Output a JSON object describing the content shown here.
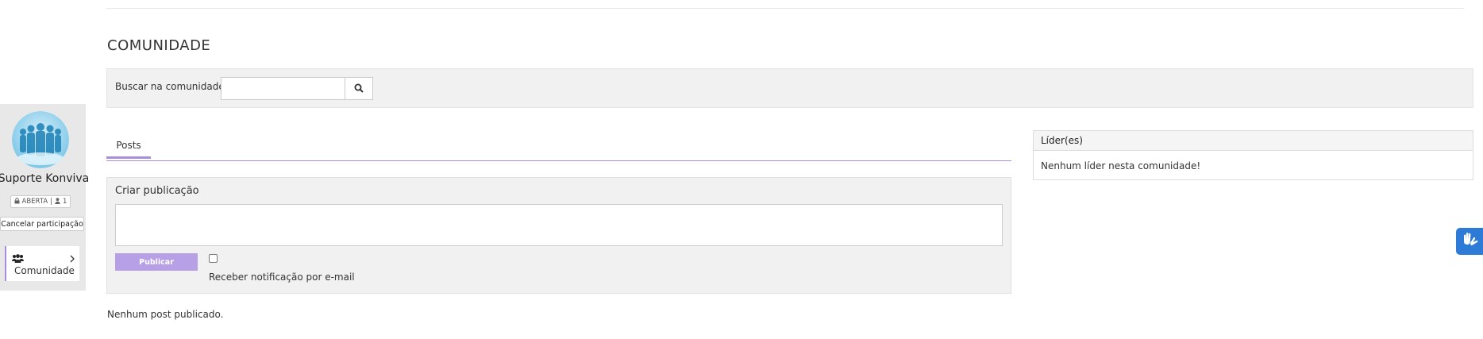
{
  "page": {
    "title": "COMUNIDADE"
  },
  "search": {
    "label": "Buscar na comunidade:",
    "value": "",
    "placeholder": ""
  },
  "profile": {
    "name": "Suporte Konviva",
    "status": "ABERTA",
    "separator": "|",
    "members": "1",
    "leave_label": "Cancelar participação",
    "menu_label": "Comunidade"
  },
  "tabs": [
    {
      "label": "Posts"
    }
  ],
  "create_post": {
    "title": "Criar publicação",
    "text": "",
    "publish_label": "Publicar",
    "notify_label": "Receber notificação por e-mail"
  },
  "feed": {
    "empty_message": "Nenhum post publicado."
  },
  "leaders": {
    "title": "Líder(es)",
    "empty_message": "Nenhum líder nesta comunidade!"
  },
  "colors": {
    "accent": "#a98ed9",
    "button": "#b7a0e6",
    "a11y": "#2d7bd6",
    "panel": "#f1f1f1"
  },
  "icons": {
    "search": "search-icon",
    "lock": "lock-icon",
    "user": "user-icon",
    "group": "group-icon",
    "chevron": "chevron-right-icon",
    "accessibility": "sign-language-icon"
  }
}
